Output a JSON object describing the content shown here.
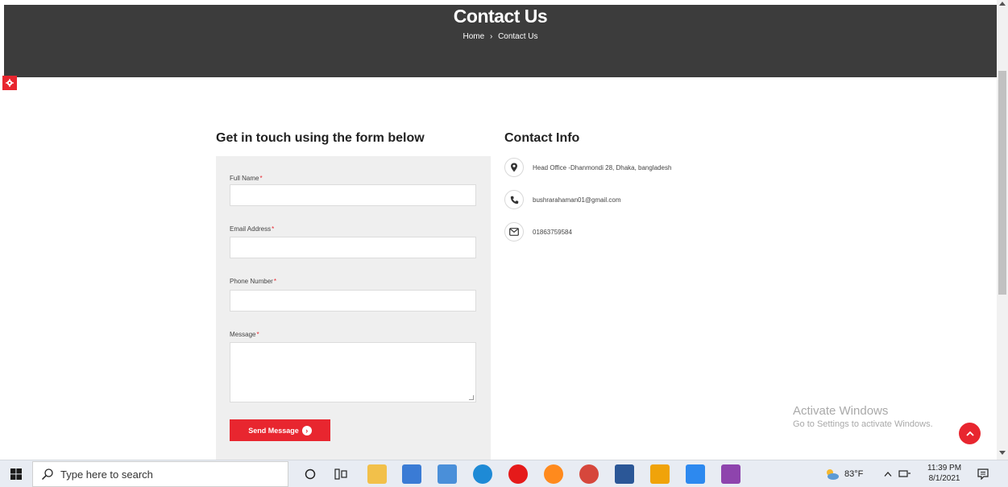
{
  "banner": {
    "title": "Contact Us",
    "breadcrumb_home": "Home",
    "breadcrumb_separator": "›",
    "breadcrumb_current": "Contact Us",
    "background": "#3c3c3c"
  },
  "form": {
    "heading": "Get in touch using the form below",
    "required_mark": "*",
    "fields": {
      "full_name": {
        "label": "Full Name",
        "value": ""
      },
      "email": {
        "label": "Email Address",
        "value": ""
      },
      "phone": {
        "label": "Phone Number",
        "value": ""
      },
      "message": {
        "label": "Message",
        "value": ""
      }
    },
    "submit_label": "Send Message",
    "submit_icon": "›"
  },
  "contact_info": {
    "heading": "Contact Info",
    "items": [
      {
        "icon": "map-pin-icon",
        "text": "Head Office -Dhanmondi 28, Dhaka, bangladesh"
      },
      {
        "icon": "phone-icon",
        "text": "bushrarahaman01@gmail.com"
      },
      {
        "icon": "envelope-icon",
        "text": "01863759584"
      }
    ]
  },
  "watermark": {
    "line1": "Activate Windows",
    "line2": "Go to Settings to activate Windows."
  },
  "colors": {
    "accent": "#e8262f",
    "panel": "#efefef"
  },
  "taskbar": {
    "search_placeholder": "Type here to search",
    "weather": "83°F",
    "time": "11:39 PM",
    "date": "8/1/2021"
  }
}
